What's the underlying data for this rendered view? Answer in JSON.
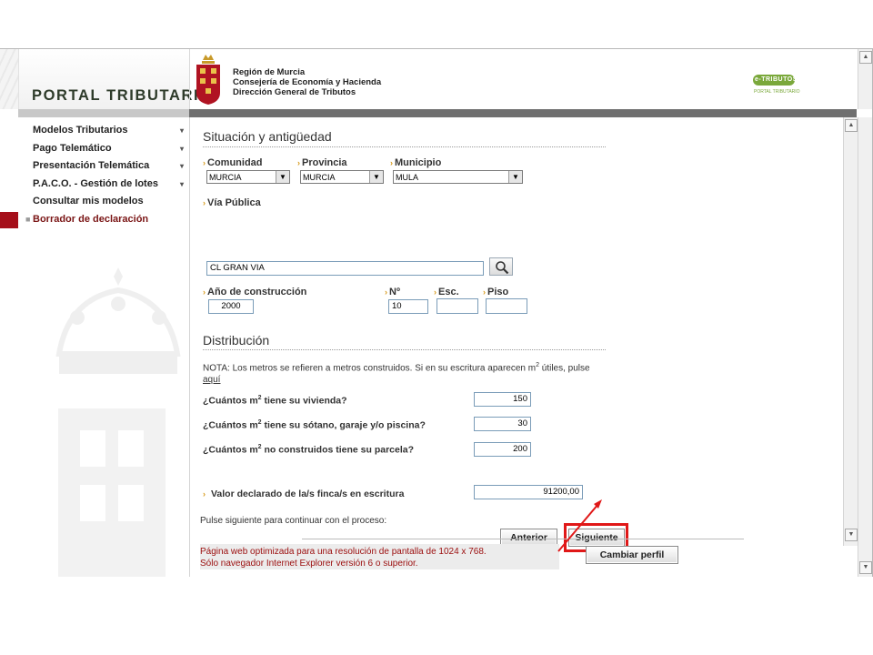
{
  "header": {
    "logo_text": "PORTAL TRIBUTARIO",
    "org_line1": "Región de Murcia",
    "org_line2": "Consejería de Economía y Hacienda",
    "org_line3": "Dirección General de Tributos",
    "etributos_text": "e-TRIBUTOS",
    "etributos_sub": "PORTAL TRIBUTARIO"
  },
  "sidebar": {
    "items": [
      {
        "label": "Modelos Tributarios",
        "arrow": "▾"
      },
      {
        "label": "Pago Telemático",
        "arrow": "▾"
      },
      {
        "label": "Presentación Telemática",
        "arrow": "▾"
      },
      {
        "label": "P.A.C.O. - Gestión de lotes",
        "arrow": "▾"
      },
      {
        "label": "Consultar mis modelos"
      },
      {
        "label": "Borrador de declaración"
      }
    ]
  },
  "situacion": {
    "title": "Situación y antigüedad",
    "comunidad_label": "Comunidad",
    "comunidad_value": "MURCIA",
    "provincia_label": "Provincia",
    "provincia_value": "MURCIA",
    "municipio_label": "Municipio",
    "municipio_value": "MULA",
    "via_label": "Vía Pública",
    "via_value": "CL GRAN VIA",
    "anio_label": "Año de construcción",
    "anio_value": "2000",
    "num_label": "Nº",
    "num_value": "10",
    "esc_label": "Esc.",
    "esc_value": "",
    "piso_label": "Piso",
    "piso_value": ""
  },
  "distribucion": {
    "title": "Distribución",
    "note_part1": "NOTA: Los metros se refieren a metros construidos. Si en su escritura aparecen m",
    "note_sup": "2",
    "note_part2": " útiles, pulse",
    "note_link": "aquí",
    "q1_a": "¿Cuántos m",
    "q1_b": " tiene su vivienda?",
    "q1_value": "150",
    "q2_a": "¿Cuántos m",
    "q2_b": " tiene su sótano, garaje y/o piscina?",
    "q2_value": "30",
    "q3_a": "¿Cuántos m",
    "q3_b": " no construidos tiene su parcela?",
    "q3_value": "200",
    "sup": "2",
    "valor_label": "Valor declarado de la/s finca/s en escritura",
    "valor_value": "91200,00",
    "continue_text": "Pulse siguiente para continuar con el proceso:",
    "anterior_label": "Anterior",
    "siguiente_label": "Siguiente"
  },
  "footer": {
    "line1": "Página web optimizada para una resolución de pantalla de 1024 x 768.",
    "line2": "Sólo navegador Internet Explorer versión 6 o superior.",
    "cambiar_label": "Cambiar perfil"
  },
  "colors": {
    "accent_red": "#a50f1a",
    "highlight_red": "#e01818",
    "label_arrow": "#d79a1a"
  }
}
